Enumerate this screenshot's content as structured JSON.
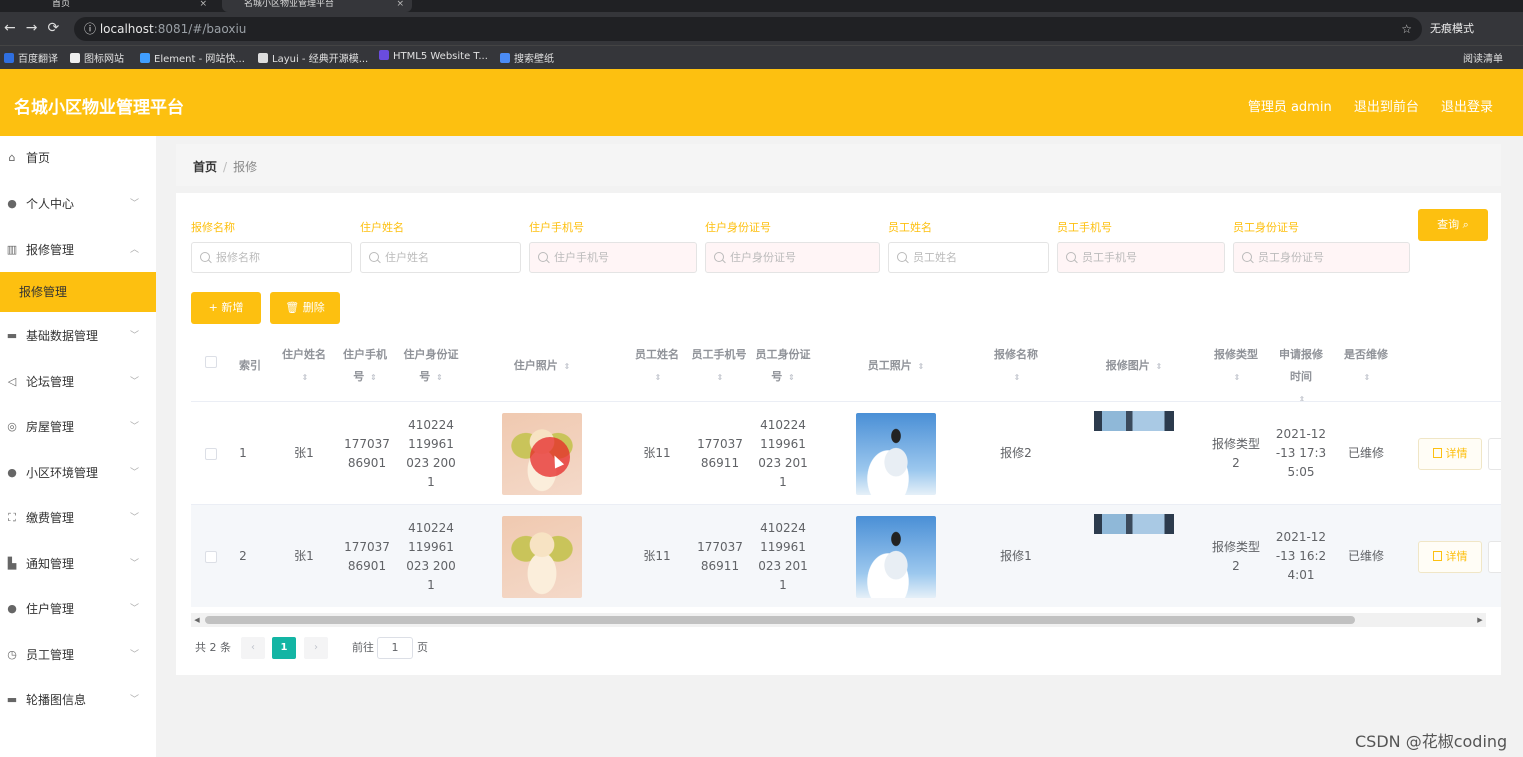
{
  "browser": {
    "tabs": [
      {
        "label": "首页"
      },
      {
        "label": "名城小区物业管理平台"
      }
    ],
    "url_host": "localhost",
    "url_rest": ":8081/#/baoxiu",
    "incognito_label": "无痕模式",
    "bookmarks": [
      "百度翻译",
      "图标网站",
      "Element - 网站快...",
      "Layui - 经典开源模...",
      "HTML5 Website T...",
      "搜索壁纸"
    ],
    "reading_list": "阅读清单"
  },
  "header": {
    "title": "名城小区物业管理平台",
    "user": "管理员 admin",
    "back_front": "退出到前台",
    "logout": "退出登录"
  },
  "sidebar": {
    "items": [
      {
        "label": "首页",
        "icon": "home-icon"
      },
      {
        "label": "个人中心",
        "icon": "user-icon"
      },
      {
        "label": "报修管理",
        "icon": "chart-icon"
      },
      {
        "label": "基础数据管理",
        "icon": "message-icon"
      },
      {
        "label": "论坛管理",
        "icon": "send-icon"
      },
      {
        "label": "房屋管理",
        "icon": "circle-icon"
      },
      {
        "label": "小区环境管理",
        "icon": "user-icon"
      },
      {
        "label": "缴费管理",
        "icon": "fullscreen-icon"
      },
      {
        "label": "通知管理",
        "icon": "thumb-icon"
      },
      {
        "label": "住户管理",
        "icon": "location-icon"
      },
      {
        "label": "员工管理",
        "icon": "clock-icon"
      },
      {
        "label": "轮播图信息",
        "icon": "bookmark-icon"
      }
    ],
    "active_sub": "报修管理"
  },
  "breadcrumb": {
    "home": "首页",
    "current": "报修"
  },
  "filters": [
    {
      "label": "报修名称",
      "placeholder": "报修名称"
    },
    {
      "label": "住户姓名",
      "placeholder": "住户姓名"
    },
    {
      "label": "住户手机号",
      "placeholder": "住户手机号"
    },
    {
      "label": "住户身份证号",
      "placeholder": "住户身份证号"
    },
    {
      "label": "员工姓名",
      "placeholder": "员工姓名"
    },
    {
      "label": "员工手机号",
      "placeholder": "员工手机号"
    },
    {
      "label": "员工身份证号",
      "placeholder": "员工身份证号"
    }
  ],
  "buttons": {
    "query": "查询",
    "add": "+ 新增",
    "delete": "删除",
    "detail": "详情"
  },
  "table": {
    "columns": [
      "索引",
      "住户姓名",
      "住户手机号",
      "住户身份证号",
      "住户照片",
      "员工姓名",
      "员工手机号",
      "员工身份证号",
      "员工照片",
      "报修名称",
      "报修图片",
      "报修类型",
      "申请报修时间",
      "是否维修"
    ],
    "rows": [
      {
        "index": "1",
        "resident_name": "张1",
        "resident_phone": "17703786901",
        "resident_id": "410224119961023 2001",
        "staff_name": "张11",
        "staff_phone": "17703786911",
        "staff_id": "410224119961023 2011",
        "repair_name": "报修2",
        "repair_type": "报修类型2",
        "apply_time": "2021-12-13 17:35:05",
        "repaired": "已维修"
      },
      {
        "index": "2",
        "resident_name": "张1",
        "resident_phone": "17703786901",
        "resident_id": "410224119961023 2001",
        "staff_name": "张11",
        "staff_phone": "17703786911",
        "staff_id": "410224119961023 2011",
        "repair_name": "报修1",
        "repair_type": "报修类型2",
        "apply_time": "2021-12-13 16:24:01",
        "repaired": "已维修"
      }
    ]
  },
  "pagination": {
    "total": "共 2 条",
    "current": "1",
    "goto": "前往",
    "page": "1",
    "page_suffix": "页"
  },
  "watermark": "CSDN @花椒coding",
  "colors": {
    "accent": "#fdc010",
    "pager_active": "#13b5a4"
  }
}
